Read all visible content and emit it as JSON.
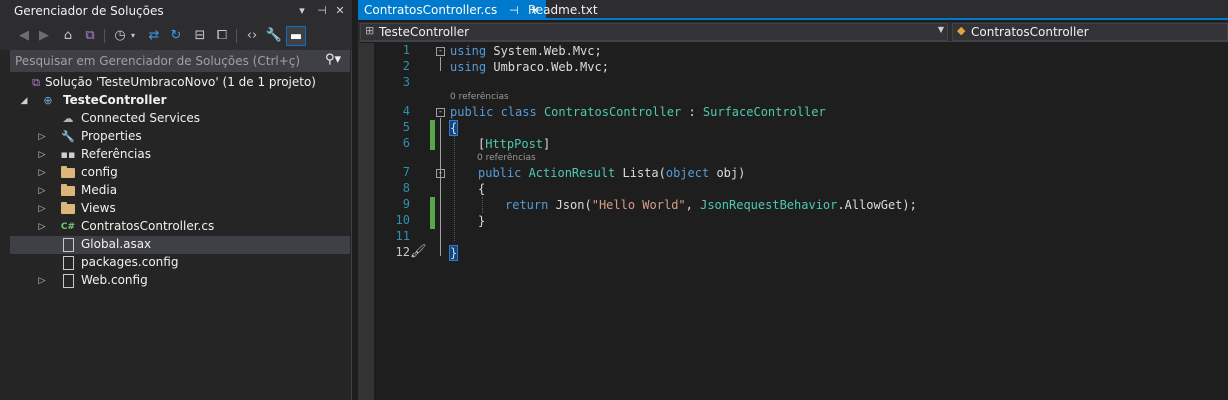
{
  "solution_explorer": {
    "title": "Gerenciador de Soluções",
    "title_buttons": [
      "▾",
      "⊣",
      "✕"
    ],
    "search_placeholder": "Pesquisar em Gerenciador de Soluções (Ctrl+ç)",
    "tree": [
      {
        "label": "Solução 'TesteUmbracoNovo' (1 de 1 projeto)",
        "icon": "solution-icon"
      },
      {
        "label": "TesteController",
        "icon": "web-project-icon"
      },
      {
        "label": "Connected Services",
        "icon": "connected-services-icon"
      },
      {
        "label": "Properties",
        "icon": "wrench-icon"
      },
      {
        "label": "Referências",
        "icon": "references-icon"
      },
      {
        "label": "config",
        "icon": "folder-icon"
      },
      {
        "label": "Media",
        "icon": "folder-icon"
      },
      {
        "label": "Views",
        "icon": "folder-icon"
      },
      {
        "label": "ContratosController.cs",
        "icon": "csharp-file-icon"
      },
      {
        "label": "Global.asax",
        "icon": "asax-file-icon"
      },
      {
        "label": "packages.config",
        "icon": "config-file-icon"
      },
      {
        "label": "Web.config",
        "icon": "config-file-icon"
      }
    ]
  },
  "tabs": [
    {
      "label": "ContratosController.cs",
      "pin": "⊣",
      "close": "✕"
    },
    {
      "label": "Readme.txt"
    }
  ],
  "navbar": {
    "project": "TesteController",
    "class": "ContratosController"
  },
  "editor": {
    "line_numbers": [
      "1",
      "2",
      "3",
      "4",
      "5",
      "6",
      "7",
      "8",
      "9",
      "10",
      "11",
      "12"
    ],
    "code_lens": [
      "0 referências",
      "0 referências"
    ],
    "code": {
      "l1_kw": "using",
      "l1_rest": " System.Web.Mvc;",
      "l2_kw": "using",
      "l2_rest": " Umbraco.Web.Mvc;",
      "l4_kw1": "public",
      "l4_kw2": " class ",
      "l4_ty1": "ContratosController",
      "l4_mid": " : ",
      "l4_ty2": "SurfaceController",
      "l5": "{",
      "l6_open": "[",
      "l6_attr": "HttpPost",
      "l6_close": "]",
      "l7_kw": "public ",
      "l7_ty": "ActionResult",
      "l7_name": " Lista(",
      "l7_kw2": "object",
      "l7_rest": " obj)",
      "l8": "{",
      "l9_kw": "return",
      "l9_a": " Json(",
      "l9_str": "\"Hello World\"",
      "l9_b": ", ",
      "l9_ty": "JsonRequestBehavior",
      "l9_c": ".AllowGet);",
      "l10": "}",
      "l12": "}"
    }
  },
  "colors": {
    "accent": "#007acc",
    "keyword": "#569cd6",
    "type": "#4ec9b0",
    "string": "#d69d85",
    "line_number": "#2b91af",
    "change_bar": "#57a64a"
  }
}
